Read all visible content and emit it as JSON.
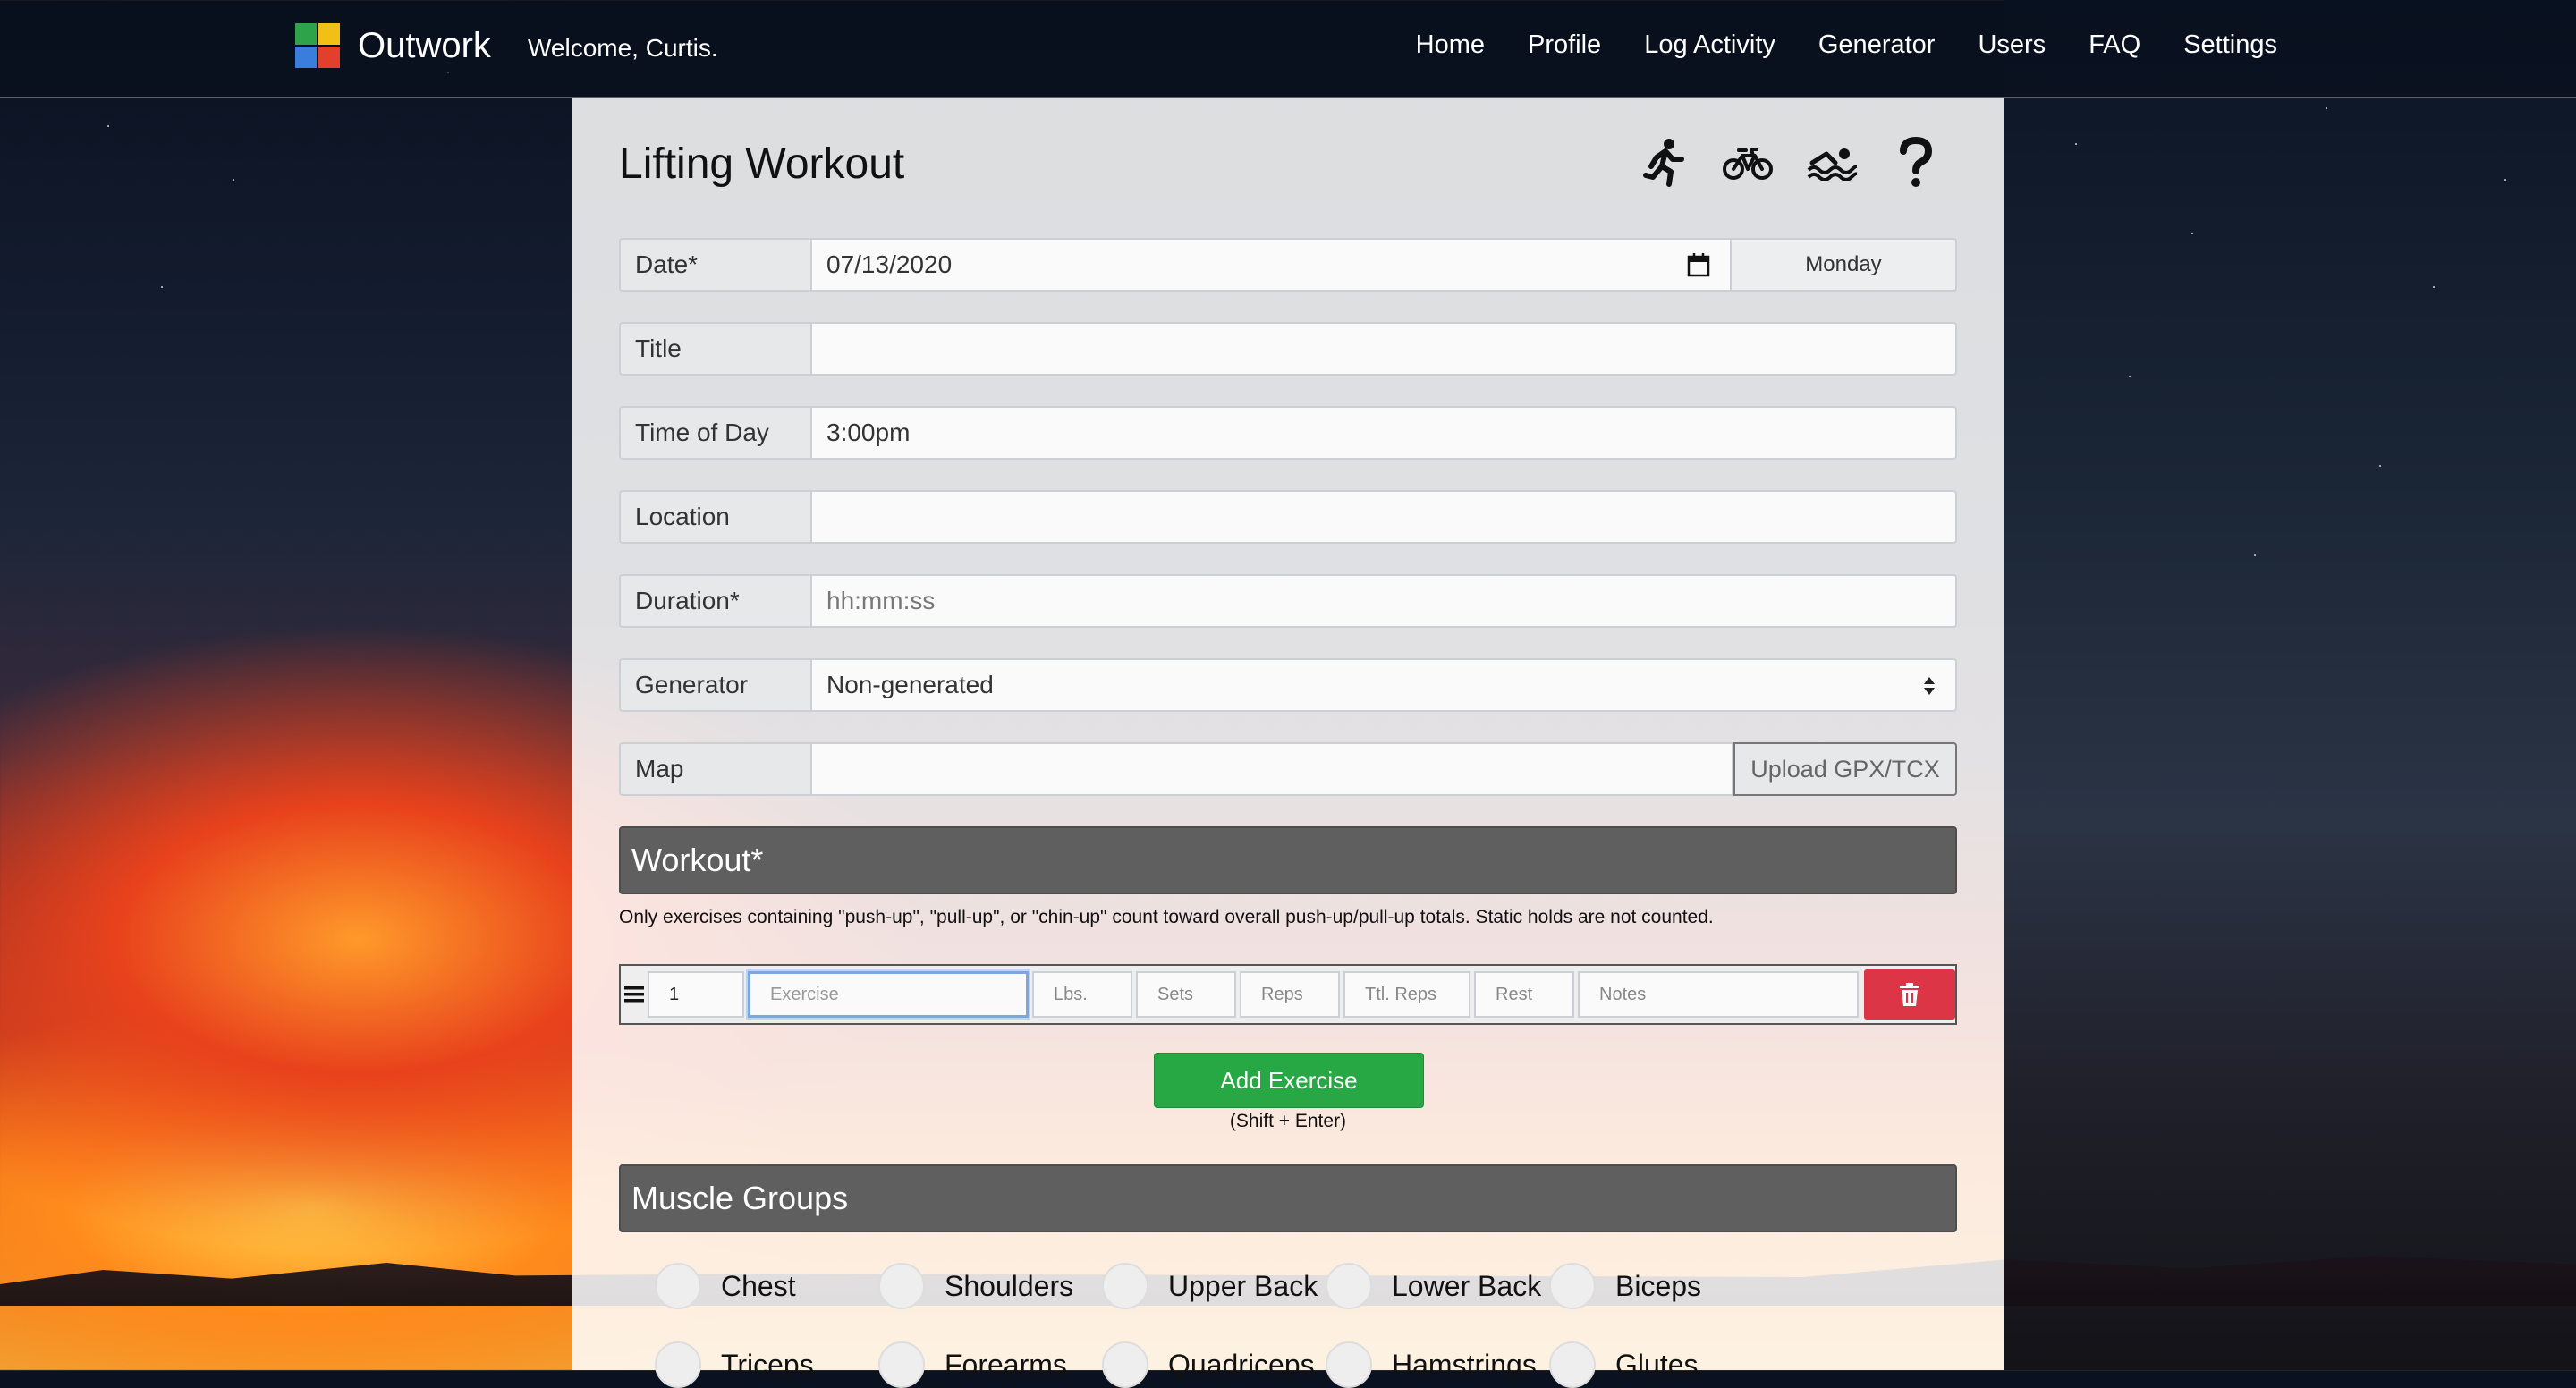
{
  "navbar": {
    "brand": "Outwork",
    "welcome": "Welcome, Curtis.",
    "links": [
      "Home",
      "Profile",
      "Log Activity",
      "Generator",
      "Users",
      "FAQ",
      "Settings"
    ],
    "logo_colors": [
      "#2fa34a",
      "#f2c014",
      "#3b7ddd",
      "#e0402c"
    ]
  },
  "page": {
    "title": "Lifting Workout",
    "activity_icons": [
      "running-icon",
      "cycling-icon",
      "swimming-icon",
      "question-icon"
    ]
  },
  "form": {
    "date": {
      "label": "Date*",
      "value": "07/13/2020",
      "weekday": "Monday"
    },
    "title": {
      "label": "Title",
      "value": ""
    },
    "time_of_day": {
      "label": "Time of Day",
      "value": "3:00pm"
    },
    "location": {
      "label": "Location",
      "value": ""
    },
    "duration": {
      "label": "Duration*",
      "placeholder": "hh:mm:ss"
    },
    "generator": {
      "label": "Generator",
      "value": "Non-generated"
    },
    "map": {
      "label": "Map",
      "value": "",
      "upload_label": "Upload GPX/TCX"
    }
  },
  "workout": {
    "heading": "Workout*",
    "note": "Only exercises containing \"push-up\", \"pull-up\", or \"chin-up\" count toward overall push-up/pull-up totals. Static holds are not counted.",
    "row": {
      "number": "1",
      "exercise_placeholder": "Exercise",
      "lbs_placeholder": "Lbs.",
      "sets_placeholder": "Sets",
      "reps_placeholder": "Reps",
      "total_reps_placeholder": "Ttl. Reps",
      "rest_placeholder": "Rest",
      "notes_placeholder": "Notes"
    },
    "add_button": "Add Exercise",
    "shortcut": "(Shift + Enter)"
  },
  "muscle_groups": {
    "heading": "Muscle Groups",
    "row1": [
      "Chest",
      "Shoulders",
      "Upper Back",
      "Lower Back",
      "Biceps"
    ],
    "row2": [
      "Triceps",
      "Forearms",
      "Quadriceps",
      "Hamstrings",
      "Glutes"
    ]
  },
  "colors": {
    "section_bar": "#5f5f5f",
    "add_button": "#28a745",
    "delete_button": "#dc3545"
  }
}
